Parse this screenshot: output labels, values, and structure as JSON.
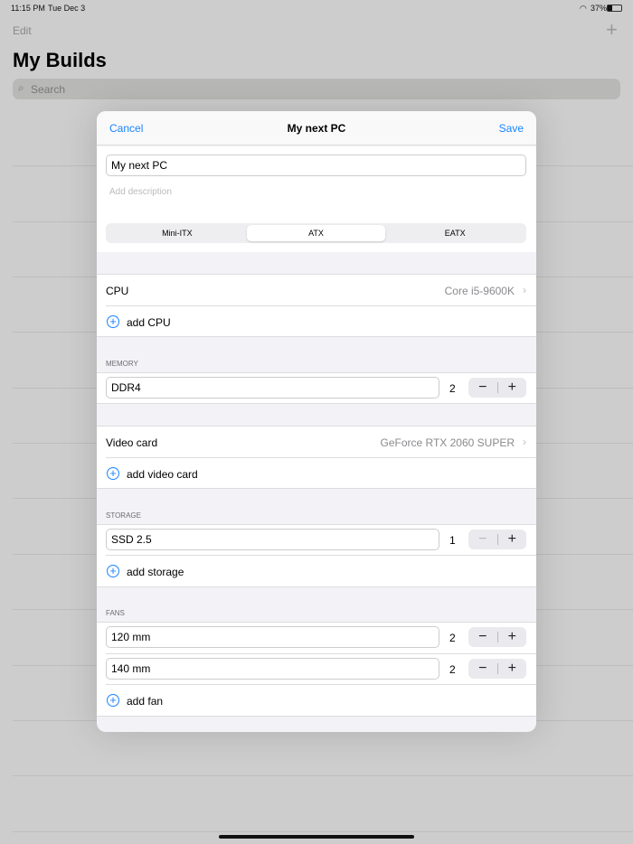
{
  "status": {
    "time": "11:15 PM",
    "date": "Tue Dec 3",
    "battery": "37%"
  },
  "background": {
    "edit": "Edit",
    "add": "+",
    "title": "My Builds",
    "search_placeholder": "Search"
  },
  "modal": {
    "cancel": "Cancel",
    "title": "My next PC",
    "save": "Save",
    "name_value": "My next PC",
    "description_placeholder": "Add description",
    "form_factors": [
      "Mini-ITX",
      "ATX",
      "EATX"
    ],
    "selected_form_factor": "ATX",
    "cpu": {
      "label": "CPU",
      "value": "Core i5-9600K",
      "add": "add CPU"
    },
    "memory": {
      "header": "MEMORY",
      "items": [
        {
          "name": "DDR4",
          "count": "2"
        }
      ]
    },
    "video": {
      "label": "Video card",
      "value": "GeForce RTX 2060 SUPER",
      "add": "add video card"
    },
    "storage": {
      "header": "STORAGE",
      "items": [
        {
          "name": "SSD 2.5",
          "count": "1"
        }
      ],
      "add": "add storage"
    },
    "fans": {
      "header": "FANS",
      "items": [
        {
          "name": "120 mm",
          "count": "2"
        },
        {
          "name": "140 mm",
          "count": "2"
        }
      ],
      "add": "add fan"
    },
    "minus": "−",
    "plus": "+"
  },
  "colors": {
    "accent": "#1a84ff"
  }
}
